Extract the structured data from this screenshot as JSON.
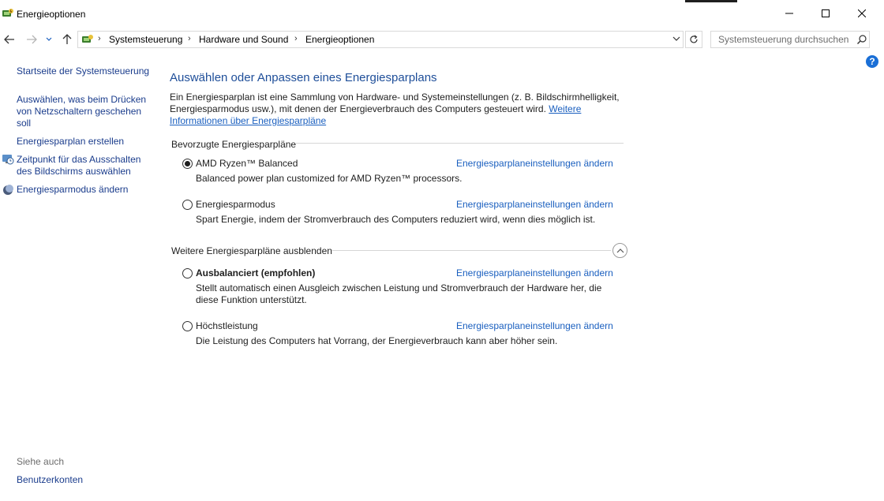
{
  "window": {
    "title": "Energieoptionen",
    "icon": "power-options-icon",
    "controls": [
      "minimize-icon",
      "maximize-icon",
      "close-icon"
    ]
  },
  "address_bar": {
    "breadcrumbs": [
      "Systemsteuerung",
      "Hardware und Sound",
      "Energieoptionen"
    ],
    "search_placeholder": "Systemsteuerung durchsuchen"
  },
  "sidebar": {
    "home_link": "Startseite der Systemsteuerung",
    "tasks": [
      {
        "label": "Auswählen, was beim Drücken von Netzschaltern geschehen soll",
        "icon": null
      },
      {
        "label": "Energiesparplan erstellen",
        "icon": null
      },
      {
        "label": "Zeitpunkt für das Ausschalten des Bildschirms auswählen",
        "icon": "monitor-clock-icon"
      },
      {
        "label": "Energiesparmodus ändern",
        "icon": "moon-icon"
      }
    ],
    "see_also_label": "Siehe auch",
    "see_also_links": [
      "Benutzerkonten"
    ]
  },
  "main": {
    "title": "Auswählen oder Anpassen eines Energiesparplans",
    "description": "Ein Energiesparplan ist eine Sammlung von Hardware- und Systemeinstellungen (z. B. Bildschirmhelligkeit, Energiesparmodus usw.), mit denen der Energieverbrauch des Computers gesteuert wird.",
    "more_info_link": "Weitere Informationen über Energiesparpläne",
    "preferred_group_label": "Bevorzugte Energiesparpläne",
    "hidden_group_label": "Weitere Energiesparpläne ausblenden",
    "change_settings_link": "Energiesparplaneinstellungen ändern",
    "preferred_plans": [
      {
        "name": "AMD Ryzen™ Balanced",
        "description": "Balanced power plan customized for AMD Ryzen™ processors.",
        "selected": true,
        "bold": false
      },
      {
        "name": "Energiesparmodus",
        "description": "Spart Energie, indem der Stromverbrauch des Computers reduziert wird, wenn dies möglich ist.",
        "selected": false,
        "bold": false
      }
    ],
    "additional_plans": [
      {
        "name": "Ausbalanciert (empfohlen)",
        "description": "Stellt automatisch einen Ausgleich zwischen Leistung und Stromverbrauch der Hardware her, die diese Funktion unterstützt.",
        "selected": false,
        "bold": true
      },
      {
        "name": "Höchstleistung",
        "description": "Die Leistung des Computers hat Vorrang, der Energieverbrauch kann aber höher sein.",
        "selected": false,
        "bold": false
      }
    ]
  },
  "colors": {
    "heading": "#1e4e99",
    "link": "#1a5fbf",
    "sidebar_link": "#1a3c8c",
    "help": "#1a6fd6"
  }
}
